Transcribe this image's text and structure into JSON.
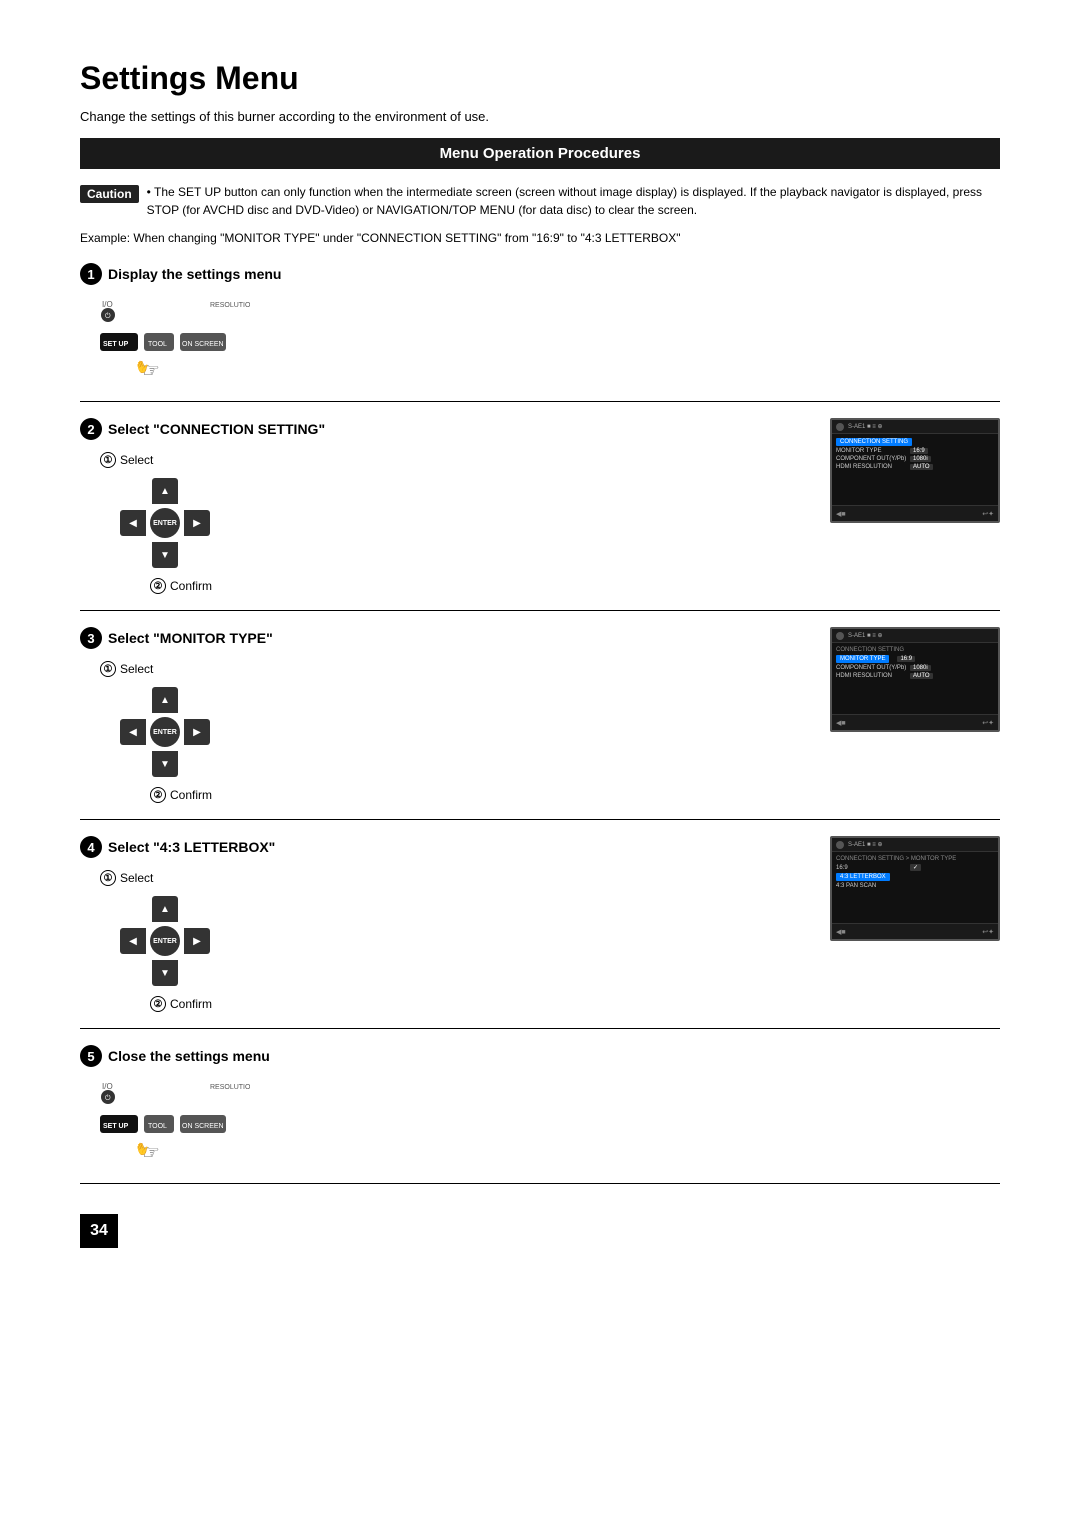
{
  "page": {
    "title": "Settings Menu",
    "intro": "Change the settings of this burner according to the environment of use.",
    "section_header": "Menu Operation Procedures",
    "caution_label": "Caution",
    "caution_text": "• The SET UP button can only function when the intermediate screen (screen without image display) is displayed. If the playback navigator is displayed, press STOP (for AVCHD disc and DVD-Video) or NAVIGATION/TOP MENU (for data disc) to clear the screen.",
    "example_text": "Example: When changing \"MONITOR TYPE\" under \"CONNECTION SETTING\" from \"16:9\" to \"4:3 LETTERBOX\"",
    "steps": [
      {
        "number": "1",
        "title": "Display the settings menu",
        "has_dpad": false,
        "has_remote_buttons": true
      },
      {
        "number": "2",
        "title": "Select \"CONNECTION SETTING\"",
        "sub1": "Select",
        "sub2": "Confirm",
        "has_dpad": true,
        "has_screen": true
      },
      {
        "number": "3",
        "title": "Select \"MONITOR TYPE\"",
        "sub1": "Select",
        "sub2": "Confirm",
        "has_dpad": true,
        "has_screen": true
      },
      {
        "number": "4",
        "title": "Select \"4:3 LETTERBOX\"",
        "sub1": "Select",
        "sub2": "Confirm",
        "has_dpad": true,
        "has_screen": true
      },
      {
        "number": "5",
        "title": "Close the settings menu",
        "has_dpad": false,
        "has_remote_buttons": true
      }
    ],
    "page_number": "34",
    "remote_buttons": {
      "setup": "SET UP",
      "tool": "TOOL",
      "on_screen": "ON SCREEN",
      "power_label": "I/O",
      "resolution_label": "RESOLUTION"
    }
  }
}
